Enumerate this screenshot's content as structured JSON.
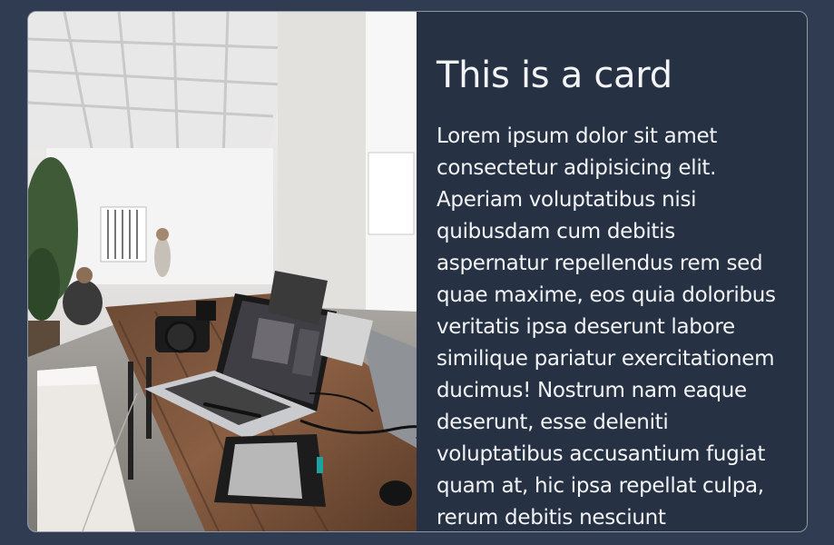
{
  "card": {
    "image_subject": "workspace-photo",
    "title": "This is a card",
    "text": "Lorem ipsum dolor sit amet consectetur adipisicing elit. Aperiam voluptatibus nisi quibusdam cum debitis aspernatur repellendus rem sed quae maxime, eos quia doloribus veritatis ipsa deserunt labore similique pariatur exercitationem ducimus! Nostrum nam eaque deserunt, esse deleniti voluptatibus accusantium fugiat quam at, hic ipsa repellat culpa, rerum debitis nesciunt recusandae."
  },
  "colors": {
    "page_background": "#2f3c51",
    "card_background": "#263244",
    "card_border": "#8e97a4",
    "text": "#f3f4f6"
  }
}
